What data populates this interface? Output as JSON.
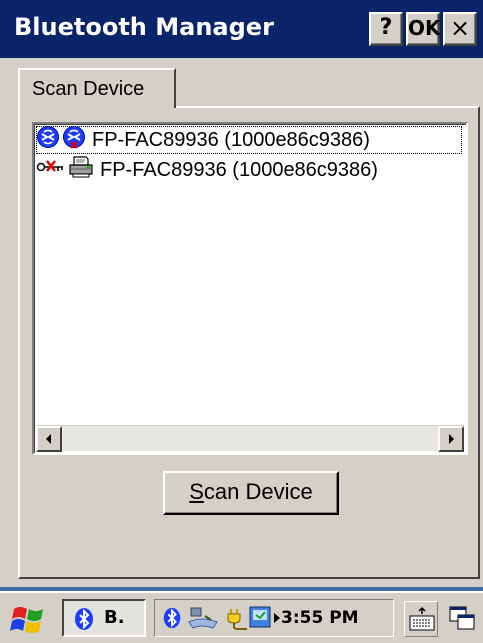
{
  "window": {
    "title": "Bluetooth Manager",
    "help_label": "?",
    "ok_label": "OK",
    "close_label": "×"
  },
  "tabs": [
    {
      "label": "Scan Device",
      "active": true
    }
  ],
  "device_list": {
    "items": [
      {
        "label": "FP-FAC89936 (1000e86c9386)",
        "icons": [
          "bluetooth-connect-icon",
          "bluetooth-disconnect-icon"
        ],
        "selected": true
      },
      {
        "label": "FP-FAC89936 (1000e86c9386)",
        "icons": [
          "unpaired-key-icon",
          "printer-icon"
        ],
        "selected": false
      }
    ]
  },
  "buttons": {
    "scan_device_prefix": "",
    "scan_device_mnemonic": "S",
    "scan_device_rest": "can Device"
  },
  "taskbar": {
    "task_label": "B.",
    "clock": "3:55 PM",
    "tray_icons": [
      "bluetooth-icon",
      "network-icon",
      "power-plug-icon",
      "sync-icon",
      "tray-arrow-icon"
    ]
  },
  "colors": {
    "title_bar": "#0a246a",
    "face": "#d4d0c8",
    "desktop": "#3a6ea5",
    "bluetooth_blue": "#1e3cff",
    "alert_red": "#e00000"
  }
}
